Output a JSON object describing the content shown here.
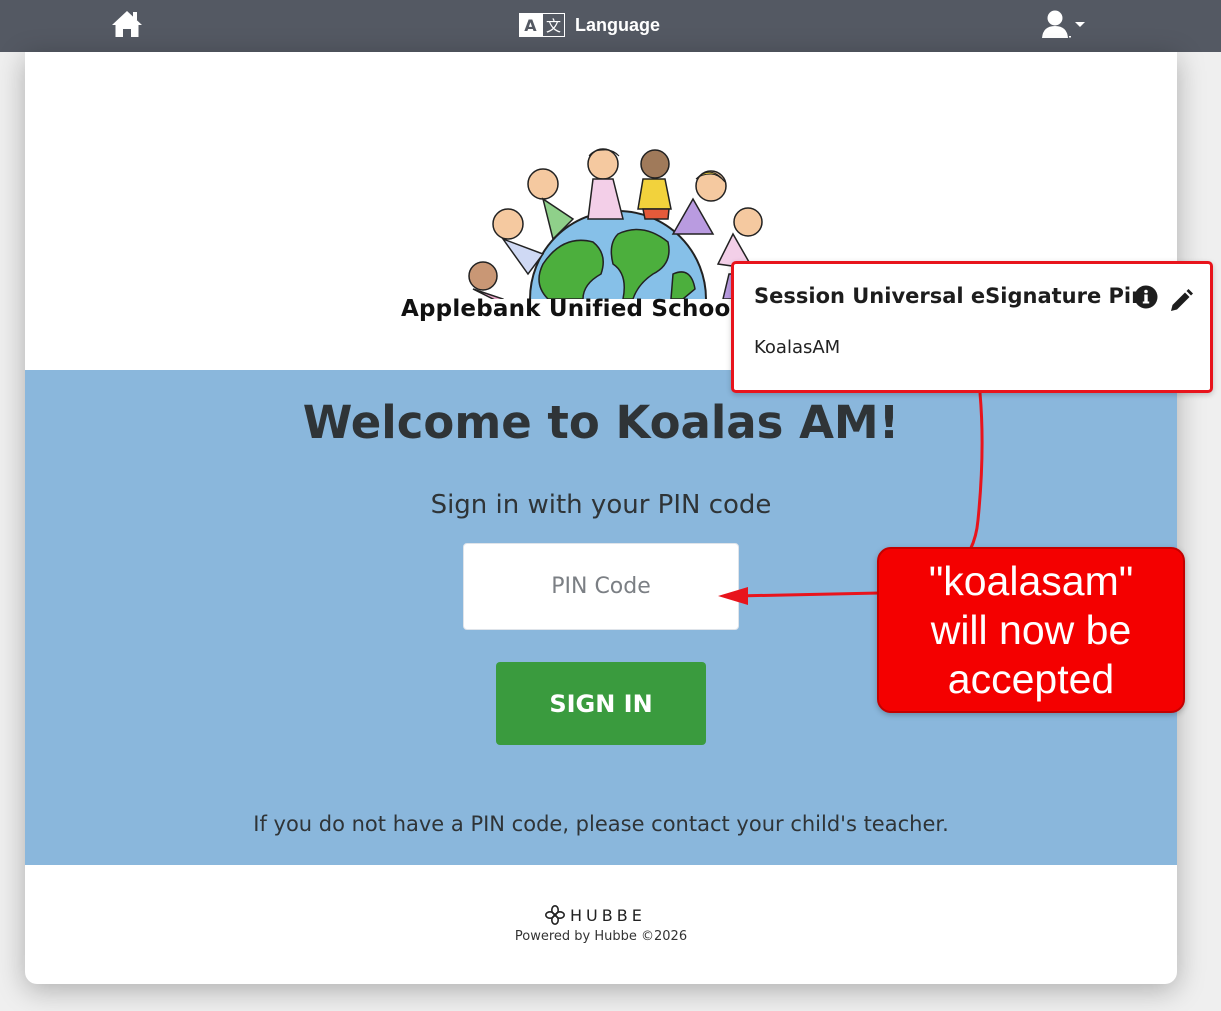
{
  "topbar": {
    "home_icon": "home-icon",
    "language_icon": "translate-icon",
    "language_label": "Language",
    "user_icon": "user-icon",
    "caret_icon": "caret-down-icon"
  },
  "logo": {
    "school_name": "Applebank Unified School D"
  },
  "main": {
    "welcome": "Welcome to Koalas AM!",
    "subtitle": "Sign in with your PIN code",
    "pin_placeholder": "PIN Code",
    "signin_label": "SIGN IN",
    "help_text": "If you do not have a PIN code, please contact your child's teacher."
  },
  "footer": {
    "brand": "HUBBE",
    "powered": "Powered by Hubbe ©2026"
  },
  "popup": {
    "title": "Session Universal eSignature Pin",
    "value": "KoalasAM",
    "info_icon": "info-icon",
    "edit_icon": "pencil-icon"
  },
  "callout": {
    "line1": "\"koalasam\"",
    "line2": "will now be",
    "line3": "accepted"
  },
  "colors": {
    "topbar": "#545963",
    "blue_section": "#8ab7dc",
    "signin_button": "#3a9b3e",
    "annotation_red": "#f40000"
  }
}
